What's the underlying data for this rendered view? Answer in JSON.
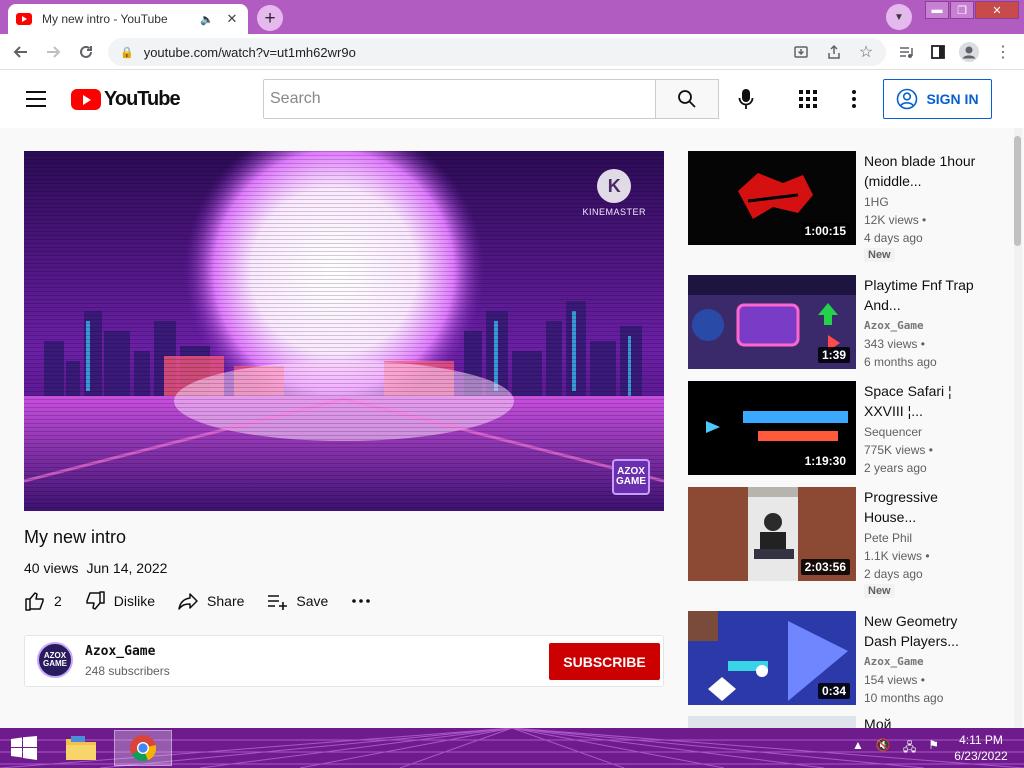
{
  "browser": {
    "tab_title": "My new intro - YouTube",
    "url": "youtube.com/watch?v=ut1mh62wr9o"
  },
  "youtube": {
    "logo_text": "YouTube",
    "search_placeholder": "Search",
    "sign_in": "SIGN IN"
  },
  "video": {
    "title": "My new intro",
    "views": "40 views",
    "date": "Jun 14, 2022",
    "likes": "2",
    "dislike_label": "Dislike",
    "share_label": "Share",
    "save_label": "Save",
    "overlay_brand": "KINEMASTER",
    "overlay_logo_letter": "K",
    "watermark_line1": "AZOX",
    "watermark_line2": "GAME"
  },
  "channel": {
    "name": "Azox_Game",
    "subscribers": "248 subscribers",
    "avatar_line1": "AZOX",
    "avatar_line2": "GAME",
    "subscribe_label": "SUBSCRIBE"
  },
  "recommendations": [
    {
      "title": "Neon blade 1hour (middle...",
      "channel": "1HG",
      "views": "12K views •",
      "age": "4 days ago",
      "badge": "New",
      "duration": "1:00:15"
    },
    {
      "title": "Playtime Fnf Trap And...",
      "channel": "Azox_Game",
      "views": "343 views •",
      "age": "6 months ago",
      "badge": "",
      "duration": "1:39"
    },
    {
      "title": "Space Safari ¦ XXVIII ¦...",
      "channel": "Sequencer",
      "views": "775K views •",
      "age": "2 years ago",
      "badge": "",
      "duration": "1:19:30"
    },
    {
      "title": "Progressive House...",
      "channel": "Pete Phil",
      "views": "1.1K views •",
      "age": "2 days ago",
      "badge": "New",
      "duration": "2:03:56"
    },
    {
      "title": "New Geometry Dash Players...",
      "channel": "Azox_Game",
      "views": "154 views •",
      "age": "10 months ago",
      "badge": "",
      "duration": "0:34"
    }
  ],
  "partial_next_title": "Мой",
  "taskbar": {
    "time": "4:11 PM",
    "date": "6/23/2022"
  },
  "colors": {
    "theme_purple": "#b15cc0",
    "youtube_red": "#ff0000",
    "subscribe_red": "#cc0000",
    "signin_blue": "#065fd4",
    "taskbar": "#6e1c8c"
  }
}
